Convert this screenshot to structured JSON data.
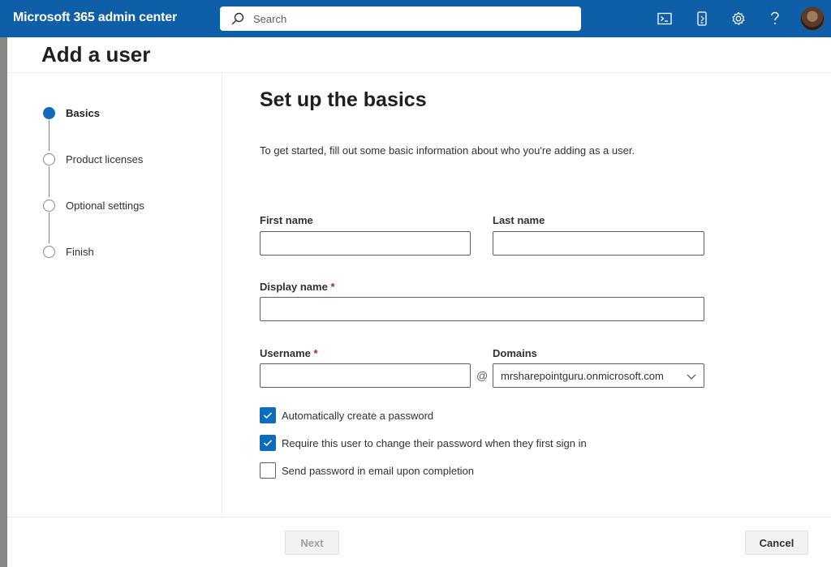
{
  "header": {
    "app_title": "Microsoft 365 admin center",
    "search_placeholder": "Search",
    "icons": [
      "terminal-icon",
      "mobile-app-icon",
      "gear-icon",
      "help-icon"
    ]
  },
  "page": {
    "title": "Add a user"
  },
  "stepper": {
    "steps": [
      {
        "label": "Basics",
        "state": "active"
      },
      {
        "label": "Product licenses",
        "state": "pending"
      },
      {
        "label": "Optional settings",
        "state": "pending"
      },
      {
        "label": "Finish",
        "state": "pending"
      }
    ]
  },
  "form": {
    "title": "Set up the basics",
    "intro": "To get started, fill out some basic information about who you're adding as a user.",
    "first_name": {
      "label": "First name",
      "value": ""
    },
    "last_name": {
      "label": "Last name",
      "value": ""
    },
    "display_name": {
      "label": "Display name",
      "required_mark": "*",
      "value": ""
    },
    "username": {
      "label": "Username",
      "required_mark": "*",
      "value": ""
    },
    "at_sign": "@",
    "domains": {
      "label": "Domains",
      "value": "mrsharepointguru.onmicrosoft.com"
    },
    "checkboxes": [
      {
        "label": "Automatically create a password",
        "checked": true
      },
      {
        "label": "Require this user to change their password when they first sign in",
        "checked": true
      },
      {
        "label": "Send password in email upon completion",
        "checked": false
      }
    ]
  },
  "footer": {
    "next_label": "Next",
    "cancel_label": "Cancel"
  },
  "colors": {
    "topbar": "#0f5fa8",
    "accent": "#0f6cbd",
    "required": "#a4262c"
  }
}
